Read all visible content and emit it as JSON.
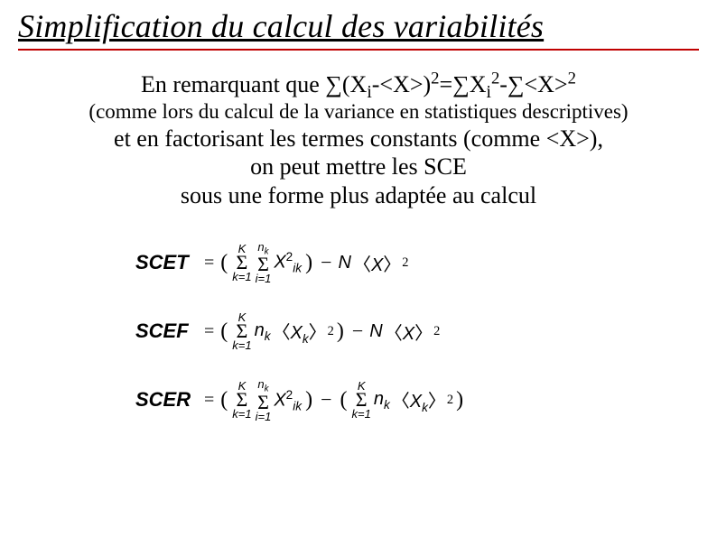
{
  "title": "Simplification du calcul des variabilités",
  "body": {
    "line1_prefix": "En remarquant que ",
    "formula_inline": "∑(X",
    "formula_sub1": "i",
    "formula_mid1": "-<X>)",
    "formula_sup1": "2",
    "formula_mid2": "=∑X",
    "formula_sub2": "i",
    "formula_sup2": "2",
    "formula_mid3": "-∑<X>",
    "formula_sup3": "2",
    "line2": "(comme lors du calcul de la variance en statistiques descriptives)",
    "line3": "et en factorisant les termes constants (comme <X>),",
    "line4": "on peut mettre les SCE",
    "line5": "sous une forme plus adaptée au calcul"
  },
  "equations": {
    "scet": {
      "lhs": "SCET",
      "sum1_top": "K",
      "sum1_bot": "k=1",
      "sum2_top_lhs": "n",
      "sum2_top_sub": "k",
      "sum2_bot": "i=1",
      "x_main": "X",
      "x_sub": "ik",
      "x_sup": "2",
      "N": "N",
      "mean_open": "〈",
      "mean_x": "X",
      "mean_close": "〉",
      "p2": "2"
    },
    "scef": {
      "lhs": "SCEF",
      "sum1_top": "K",
      "sum1_bot": "k=1",
      "n_term": "n",
      "n_sub": "k",
      "mean_xk": "X",
      "mean_xk_sub": "k",
      "N": "N",
      "xmean": "X",
      "p2": "2"
    },
    "scer": {
      "lhs": "SCER",
      "sum1_top": "K",
      "sum1_bot": "k=1",
      "sum2_top_lhs": "n",
      "sum2_top_sub": "k",
      "sum2_bot": "i=1",
      "x_main": "X",
      "x_sub": "ik",
      "x_sup": "2",
      "sum3_top": "K",
      "sum3_bot": "k=1",
      "n_term": "n",
      "n_sub": "k",
      "xk": "X",
      "xk_sub": "k",
      "p2": "2"
    }
  }
}
